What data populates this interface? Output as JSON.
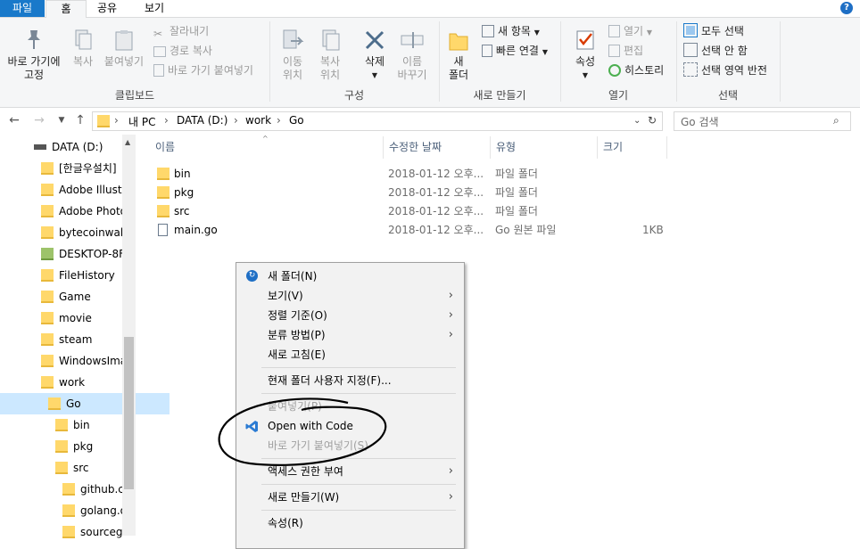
{
  "ribbon_tabs": [
    "파일",
    "홈",
    "공유",
    "보기"
  ],
  "ribbon": {
    "clipboard": {
      "pin": "바로 가기에\n고정",
      "copy": "복사",
      "paste": "붙여넣기",
      "cut": "잘라내기",
      "copy_path": "경로 복사",
      "paste_shortcut": "바로 가기 붙여넣기",
      "label": "클립보드"
    },
    "organize": {
      "move_to": "이동\n위치",
      "copy_to": "복사\n위치",
      "delete": "삭제",
      "rename": "이름\n바꾸기",
      "label": "구성"
    },
    "new": {
      "new_folder": "새\n폴더",
      "new_item": "새 항목",
      "easy_access": "빠른 연결",
      "label": "새로 만들기"
    },
    "open": {
      "properties": "속성",
      "open": "열기",
      "edit": "편집",
      "history": "히스토리",
      "label": "열기"
    },
    "select": {
      "select_all": "모두 선택",
      "select_none": "선택 안 함",
      "invert": "선택 영역 반전",
      "label": "선택"
    }
  },
  "breadcrumb": [
    "내 PC",
    "DATA (D:)",
    "work",
    "Go"
  ],
  "search_placeholder": "Go 검색",
  "nav_tree": [
    "DATA (D:)",
    "[한글우설치]",
    "Adobe Illustra",
    "Adobe Photo",
    "bytecoinwalle",
    "DESKTOP-8F",
    "FileHistory",
    "Game",
    "movie",
    "steam",
    "WindowsIma",
    "work",
    "Go",
    "bin",
    "pkg",
    "src",
    "github.co",
    "golang.o",
    "sourcegr"
  ],
  "columns": [
    "이름",
    "수정한 날짜",
    "유형",
    "크기"
  ],
  "files": [
    {
      "name": "bin",
      "date": "2018-01-12 오후...",
      "type": "파일 폴더",
      "size": ""
    },
    {
      "name": "pkg",
      "date": "2018-01-12 오후...",
      "type": "파일 폴더",
      "size": ""
    },
    {
      "name": "src",
      "date": "2018-01-12 오후...",
      "type": "파일 폴더",
      "size": ""
    },
    {
      "name": "main.go",
      "date": "2018-01-12 오후...",
      "type": "Go 원본 파일",
      "size": "1KB"
    }
  ],
  "context_menu": {
    "new_folder": "새 폴더(N)",
    "view": "보기(V)",
    "sort": "정렬 기준(O)",
    "group": "분류 방법(P)",
    "refresh": "새로 고침(E)",
    "customize": "현재 폴더 사용자 지정(F)...",
    "paste": "붙여넣기(P)",
    "open_with_code": "Open with Code",
    "paste_shortcut": "바로 가기 붙여넣기(S)",
    "give_access": "액세스 권한 부여",
    "new": "새로 만들기(W)",
    "properties": "속성(R)"
  },
  "colors": {
    "accent": "#1979ca",
    "selection": "#cce8ff",
    "folder": "#ffd86b",
    "vscode": "#2b7bd3"
  }
}
